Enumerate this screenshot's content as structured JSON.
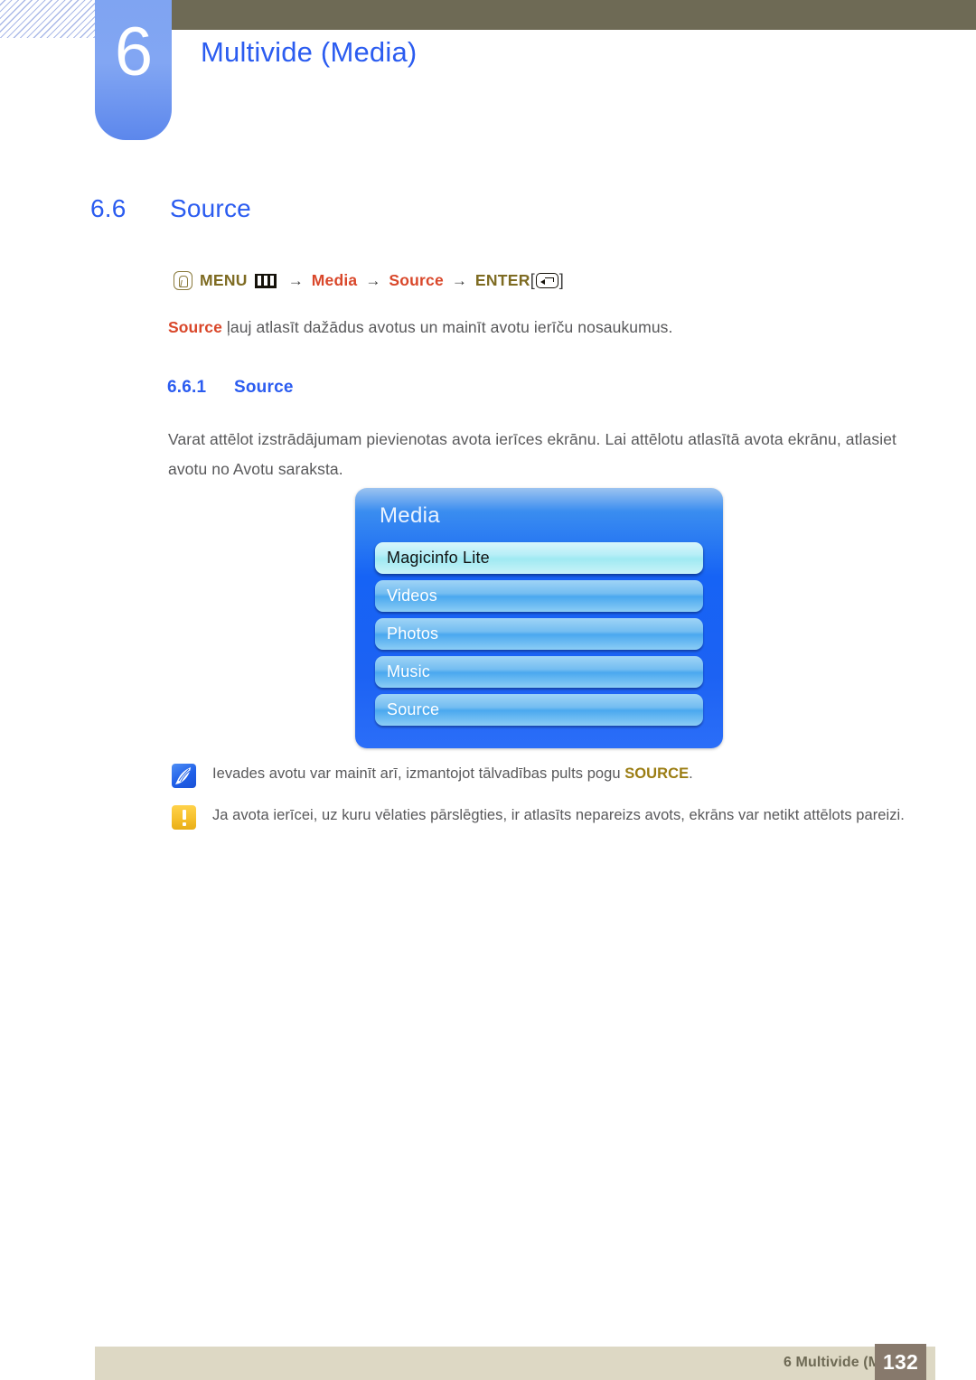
{
  "header": {
    "chapter_number": "6",
    "chapter_title": "Multivide (Media)",
    "accent_blue": "#2b5cf0",
    "bar_color": "#6e6a55"
  },
  "section": {
    "number": "6.6",
    "title": "Source"
  },
  "nav_path": {
    "press_icon": "press-button-icon",
    "menu_label": "MENU",
    "menu_icon": "menu-bars-icon",
    "arrow_1": "→",
    "media_label": "Media",
    "arrow_2": "→",
    "source_label": "Source",
    "arrow_3": "→",
    "enter_label": "ENTER",
    "bracket_open": "[",
    "enter_icon": "enter-return-icon",
    "bracket_close": "]",
    "menu_color": "#7e6b22",
    "item_color": "#d9472a"
  },
  "description": {
    "keyword": "Source",
    "text": " ļauj atlasīt dažādus avotus un mainīt avotu ierīču nosaukumus."
  },
  "subsection": {
    "number": "6.6.1",
    "title": "Source"
  },
  "paragraph": {
    "text": "Varat attēlot izstrādājumam pievienotas avota ierīces ekrānu. Lai attēlotu atlasītā avota ekrānu, atlasiet avotu no Avotu saraksta."
  },
  "osd": {
    "title": "Media",
    "items": [
      {
        "label": "Magicinfo Lite",
        "selected": true
      },
      {
        "label": "Videos",
        "selected": false
      },
      {
        "label": "Photos",
        "selected": false
      },
      {
        "label": "Music",
        "selected": false
      },
      {
        "label": "Source",
        "selected": false
      }
    ]
  },
  "notes": [
    {
      "icon": "note-quill-icon",
      "text_before": "Ievades avotu var mainīt arī, izmantojot tālvadības pults pogu ",
      "keyword": "SOURCE",
      "text_after": "."
    },
    {
      "icon": "warning-exclamation-icon",
      "text_before": "Ja avota ierīcei, uz kuru vēlaties pārslēgties, ir atlasīts nepareizs avots, ekrāns var netikt attēlots pareizi.",
      "keyword": "",
      "text_after": ""
    }
  ],
  "footer": {
    "chapter_text": "6 Multivide (Media)",
    "page_number": "132",
    "band_color": "#ddd8c4",
    "page_box_color": "#87796c"
  }
}
